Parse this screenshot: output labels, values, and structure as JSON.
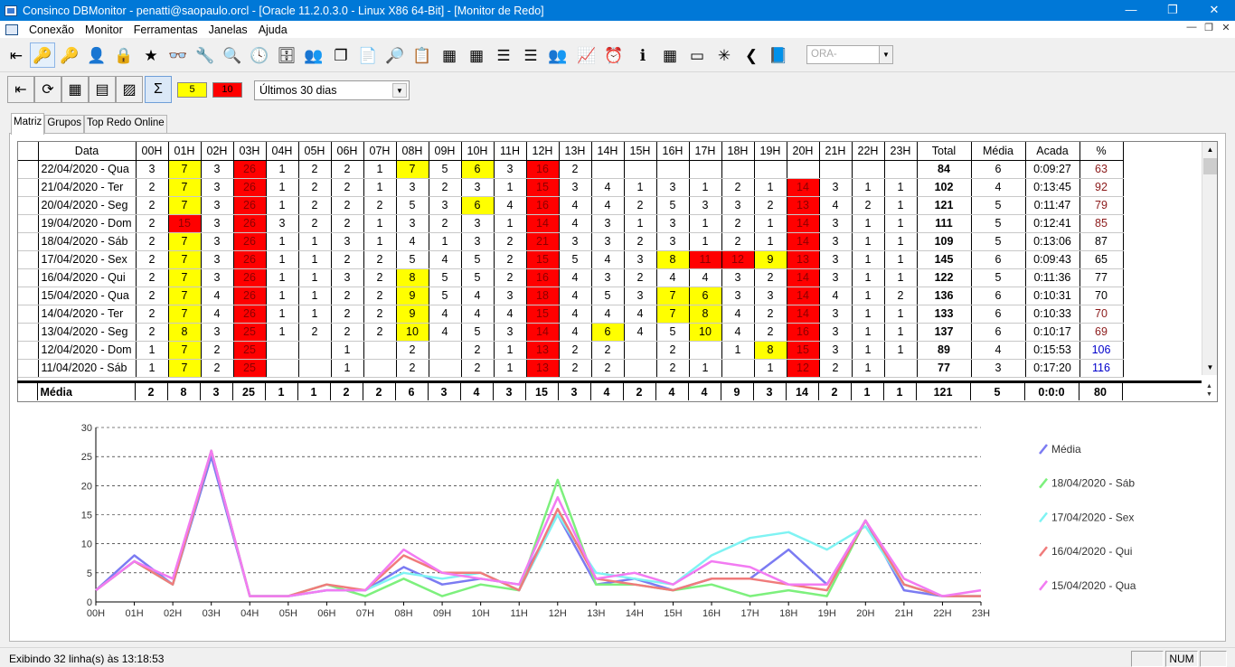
{
  "window": {
    "title": "Consinco DBMonitor - penatti@saopaulo.orcl - [Oracle 11.2.0.3.0 - Linux X86 64-Bit] - [Monitor de Redo]",
    "minimize": "—",
    "restore": "❐",
    "close": "✕"
  },
  "menu": {
    "items": [
      "Conexão",
      "Monitor",
      "Ferramentas",
      "Janelas",
      "Ajuda"
    ],
    "mdi_minimize": "—",
    "mdi_restore": "❐",
    "mdi_close": "✕"
  },
  "toolbar": {
    "icons": [
      "exit-icon",
      "key-icon",
      "key-gray-icon",
      "user-key-icon",
      "lock-icon",
      "star-icon",
      "glasses-icon",
      "tools-icon",
      "magnifier-icon",
      "clock-icon",
      "database-icon",
      "users-icon",
      "copy-icon",
      "document-icon",
      "preview-icon",
      "report-icon",
      "calendar-icon",
      "calendar-red-icon",
      "list-icon",
      "list-save-icon",
      "group-icon",
      "chart-icon",
      "alarm-icon",
      "info-icon",
      "calculator-icon",
      "oracle-icon",
      "asterisk-icon",
      "back-icon",
      "book-icon"
    ],
    "glyphs": [
      "⇤",
      "🔑",
      "🔑",
      "👤",
      "🔒",
      "★",
      "👓",
      "🔧",
      "🔍",
      "🕓",
      "🗄",
      "👥",
      "❐",
      "📄",
      "🔎",
      "📋",
      "▦",
      "▦",
      "☰",
      "☰",
      "👥",
      "📈",
      "⏰",
      "ℹ",
      "▦",
      "▭",
      "✳",
      "❮",
      "📘"
    ],
    "active_index": 1,
    "instance_combo": "ORA-"
  },
  "toolbar2": {
    "icons": [
      "exit-icon",
      "refresh-icon",
      "grid-settings-icon",
      "grid-icon",
      "chart-layout-icon",
      "sum-icon"
    ],
    "glyphs": [
      "⇤",
      "⟳",
      "▦",
      "▤",
      "▨",
      "Σ"
    ],
    "pressed_index": 5,
    "yellow_threshold": "5",
    "red_threshold": "10",
    "period": "Últimos 30 dias"
  },
  "tabs": [
    "Matriz",
    "Grupos",
    "Top Redo Online"
  ],
  "grid": {
    "headers": [
      "Data",
      "00H",
      "01H",
      "02H",
      "03H",
      "04H",
      "05H",
      "06H",
      "07H",
      "08H",
      "09H",
      "10H",
      "11H",
      "12H",
      "13H",
      "14H",
      "15H",
      "16H",
      "17H",
      "18H",
      "19H",
      "20H",
      "21H",
      "22H",
      "23H",
      "Total",
      "Média",
      "Acada",
      "%"
    ],
    "rows": [
      [
        "22/04/2020 - Qua",
        "3",
        "7",
        "3",
        "26",
        "1",
        "2",
        "2",
        "1",
        "7",
        "5",
        "6",
        "3",
        "16",
        "2",
        "",
        "",
        "",
        "",
        "",
        "",
        "",
        "",
        "",
        "",
        "84",
        "6",
        "0:09:27",
        "63"
      ],
      [
        "21/04/2020 - Ter",
        "2",
        "7",
        "3",
        "26",
        "1",
        "2",
        "2",
        "1",
        "3",
        "2",
        "3",
        "1",
        "15",
        "3",
        "4",
        "1",
        "3",
        "1",
        "2",
        "1",
        "14",
        "3",
        "1",
        "1",
        "102",
        "4",
        "0:13:45",
        "92"
      ],
      [
        "20/04/2020 - Seg",
        "2",
        "7",
        "3",
        "26",
        "1",
        "2",
        "2",
        "2",
        "5",
        "3",
        "6",
        "4",
        "16",
        "4",
        "4",
        "2",
        "5",
        "3",
        "3",
        "2",
        "13",
        "4",
        "2",
        "1",
        "121",
        "5",
        "0:11:47",
        "79"
      ],
      [
        "19/04/2020 - Dom",
        "2",
        "15",
        "3",
        "26",
        "3",
        "2",
        "2",
        "1",
        "3",
        "2",
        "3",
        "1",
        "14",
        "4",
        "3",
        "1",
        "3",
        "1",
        "2",
        "1",
        "14",
        "3",
        "1",
        "1",
        "111",
        "5",
        "0:12:41",
        "85"
      ],
      [
        "18/04/2020 - Sáb",
        "2",
        "7",
        "3",
        "26",
        "1",
        "1",
        "3",
        "1",
        "4",
        "1",
        "3",
        "2",
        "21",
        "3",
        "3",
        "2",
        "3",
        "1",
        "2",
        "1",
        "14",
        "3",
        "1",
        "1",
        "109",
        "5",
        "0:13:06",
        "87"
      ],
      [
        "17/04/2020 - Sex",
        "2",
        "7",
        "3",
        "26",
        "1",
        "1",
        "2",
        "2",
        "5",
        "4",
        "5",
        "2",
        "15",
        "5",
        "4",
        "3",
        "8",
        "11",
        "12",
        "9",
        "13",
        "3",
        "1",
        "1",
        "145",
        "6",
        "0:09:43",
        "65"
      ],
      [
        "16/04/2020 - Qui",
        "2",
        "7",
        "3",
        "26",
        "1",
        "1",
        "3",
        "2",
        "8",
        "5",
        "5",
        "2",
        "16",
        "4",
        "3",
        "2",
        "4",
        "4",
        "3",
        "2",
        "14",
        "3",
        "1",
        "1",
        "122",
        "5",
        "0:11:36",
        "77"
      ],
      [
        "15/04/2020 - Qua",
        "2",
        "7",
        "4",
        "26",
        "1",
        "1",
        "2",
        "2",
        "9",
        "5",
        "4",
        "3",
        "18",
        "4",
        "5",
        "3",
        "7",
        "6",
        "3",
        "3",
        "14",
        "4",
        "1",
        "2",
        "136",
        "6",
        "0:10:31",
        "70"
      ],
      [
        "14/04/2020 - Ter",
        "2",
        "7",
        "4",
        "26",
        "1",
        "1",
        "2",
        "2",
        "9",
        "4",
        "4",
        "4",
        "15",
        "4",
        "4",
        "4",
        "7",
        "8",
        "4",
        "2",
        "14",
        "3",
        "1",
        "1",
        "133",
        "6",
        "0:10:33",
        "70"
      ],
      [
        "13/04/2020 - Seg",
        "2",
        "8",
        "3",
        "25",
        "1",
        "2",
        "2",
        "2",
        "10",
        "4",
        "5",
        "3",
        "14",
        "4",
        "6",
        "4",
        "5",
        "10",
        "4",
        "2",
        "16",
        "3",
        "1",
        "1",
        "137",
        "6",
        "0:10:17",
        "69"
      ],
      [
        "12/04/2020 - Dom",
        "1",
        "7",
        "2",
        "25",
        "",
        "",
        "1",
        "",
        "2",
        "",
        "2",
        "1",
        "13",
        "2",
        "2",
        "",
        "2",
        "",
        "1",
        "8",
        "15",
        "3",
        "1",
        "1",
        "89",
        "4",
        "0:15:53",
        "106"
      ],
      [
        "11/04/2020 - Sáb",
        "1",
        "7",
        "2",
        "25",
        "",
        "",
        "1",
        "",
        "2",
        "",
        "2",
        "1",
        "13",
        "2",
        "2",
        "",
        "2",
        "1",
        "",
        "1",
        "12",
        "2",
        "1",
        "",
        "77",
        "3",
        "0:17:20",
        "116"
      ]
    ],
    "pct_colors": [
      "#8b1a1a",
      "#8b1a1a",
      "#8b1a1a",
      "#8b1a1a",
      "#000000",
      "#000000",
      "#000000",
      "#000000",
      "#8b1a1a",
      "#8b1a1a",
      "#0000cc",
      "#0000cc"
    ],
    "footer": [
      "Média",
      "2",
      "8",
      "3",
      "25",
      "1",
      "1",
      "2",
      "2",
      "6",
      "3",
      "4",
      "3",
      "15",
      "3",
      "4",
      "2",
      "4",
      "4",
      "9",
      "3",
      "14",
      "2",
      "1",
      "1",
      "121",
      "5",
      "0:0:0",
      "80"
    ],
    "scroll_up": "▲",
    "scroll_down": "▼",
    "spin_up": "▲",
    "spin_down": "▼"
  },
  "chart_data": {
    "type": "line",
    "categories": [
      "00H",
      "01H",
      "02H",
      "03H",
      "04H",
      "05H",
      "06H",
      "07H",
      "08H",
      "09H",
      "10H",
      "11H",
      "12H",
      "13H",
      "14H",
      "15H",
      "16H",
      "17H",
      "18H",
      "19H",
      "20H",
      "21H",
      "22H",
      "23H"
    ],
    "yticks": [
      "0",
      "5",
      "10",
      "15",
      "20",
      "25",
      "30"
    ],
    "ylim": [
      0,
      30
    ],
    "grid": "horizontal dashed",
    "legend_position": "right",
    "series": [
      {
        "name": "Média",
        "color": "#7b7bf2",
        "values": [
          2,
          8,
          3,
          25,
          1,
          1,
          2,
          2,
          6,
          3,
          4,
          3,
          15,
          3,
          4,
          2,
          4,
          4,
          9,
          3,
          14,
          2,
          1,
          1
        ]
      },
      {
        "name": "18/04/2020 - Sáb",
        "color": "#7df07d",
        "values": [
          2,
          7,
          3,
          26,
          1,
          1,
          3,
          1,
          4,
          1,
          3,
          2,
          21,
          3,
          3,
          2,
          3,
          1,
          2,
          1,
          14,
          3,
          1,
          1
        ]
      },
      {
        "name": "17/04/2020 - Sex",
        "color": "#7ff3f3",
        "values": [
          2,
          7,
          3,
          26,
          1,
          1,
          2,
          2,
          5,
          4,
          5,
          2,
          15,
          5,
          4,
          3,
          8,
          11,
          12,
          9,
          13,
          3,
          1,
          1
        ]
      },
      {
        "name": "16/04/2020 - Qui",
        "color": "#f07b7b",
        "values": [
          2,
          7,
          3,
          26,
          1,
          1,
          3,
          2,
          8,
          5,
          5,
          2,
          16,
          4,
          3,
          2,
          4,
          4,
          3,
          2,
          14,
          3,
          1,
          1
        ]
      },
      {
        "name": "15/04/2020 - Qua",
        "color": "#f27bf2",
        "values": [
          2,
          7,
          4,
          26,
          1,
          1,
          2,
          2,
          9,
          5,
          4,
          3,
          18,
          4,
          5,
          3,
          7,
          6,
          3,
          3,
          14,
          4,
          1,
          2
        ]
      }
    ]
  },
  "status": {
    "message": "Exibindo 32 linha(s) às 13:18:53",
    "num": "NUM"
  }
}
